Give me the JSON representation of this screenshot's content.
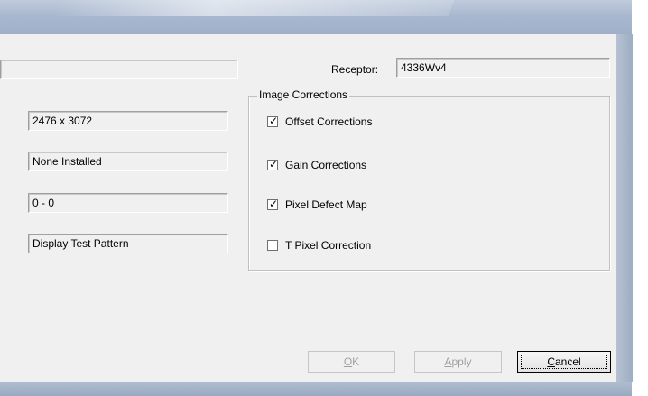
{
  "receptor": {
    "label": "Receptor:",
    "value": "4336Wv4"
  },
  "fields": {
    "resolution": "2476 x 3072",
    "installed": "None Installed",
    "range": "0 - 0",
    "display": "Display Test Pattern"
  },
  "image_corrections": {
    "title": "Image Corrections",
    "items": [
      {
        "label": "Offset Corrections",
        "checked": true
      },
      {
        "label": "Gain Corrections",
        "checked": true
      },
      {
        "label": "Pixel Defect Map",
        "checked": true
      },
      {
        "label": "T Pixel Correction",
        "checked": false
      }
    ],
    "check_glyph": "✓"
  },
  "buttons": {
    "ok": {
      "accel": "O",
      "rest": "K"
    },
    "apply": {
      "accel": "A",
      "rest": "pply"
    },
    "cancel": {
      "accel": "C",
      "rest": "ancel"
    }
  }
}
